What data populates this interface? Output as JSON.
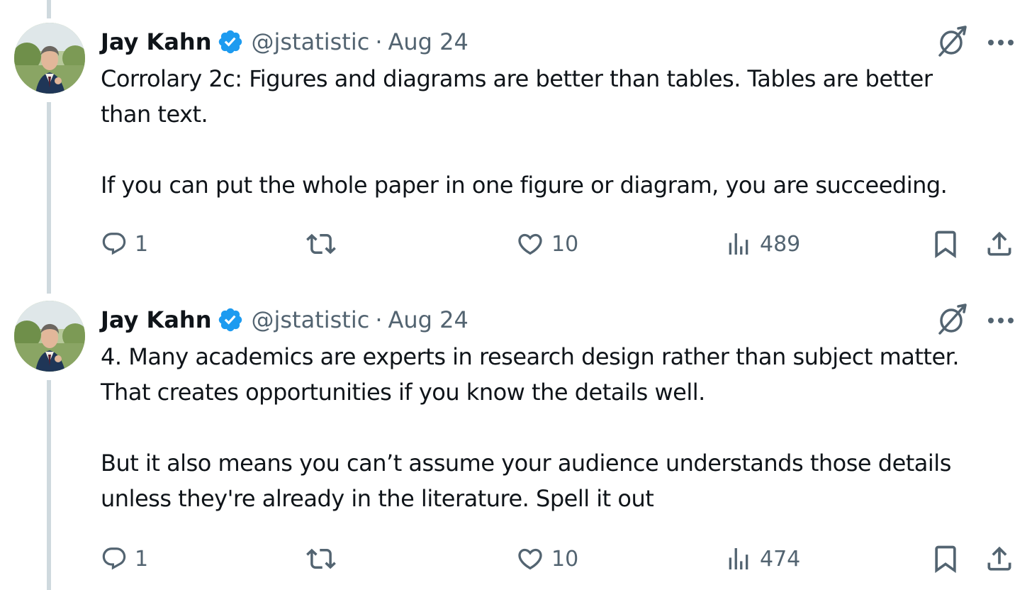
{
  "tweets": [
    {
      "author": {
        "name": "Jay Kahn",
        "handle": "@jstatistic",
        "separator": "·",
        "date": "Aug 24",
        "verified": true
      },
      "text_lines": [
        "Corrolary 2c: Figures and diagrams are better than tables. Tables are better",
        "than text.",
        "",
        "If you can put the whole paper in one figure or diagram, you are succeeding."
      ],
      "metrics": {
        "replies": "1",
        "reposts": "",
        "likes": "10",
        "views": "489"
      }
    },
    {
      "author": {
        "name": "Jay Kahn",
        "handle": "@jstatistic",
        "separator": "·",
        "date": "Aug 24",
        "verified": true
      },
      "text_lines": [
        "4. Many academics are experts in research design rather than subject matter.",
        "That creates opportunities if you know the details well.",
        "",
        "But it also means you can’t assume your audience understands those details",
        "unless they're already in the literature. Spell it out"
      ],
      "metrics": {
        "replies": "1",
        "reposts": "",
        "likes": "10",
        "views": "474"
      }
    }
  ],
  "icons": {
    "verified": "verified-badge-icon",
    "grok": "grok-icon",
    "more": "more-dots-icon",
    "reply": "reply-icon",
    "repost": "repost-icon",
    "like": "heart-icon",
    "views": "views-bar-icon",
    "bookmark": "bookmark-icon",
    "share": "share-icon"
  },
  "colors": {
    "text": "#0f1419",
    "secondary": "#536471",
    "verified": "#1d9bf0",
    "thread_line": "#cfd9de"
  }
}
